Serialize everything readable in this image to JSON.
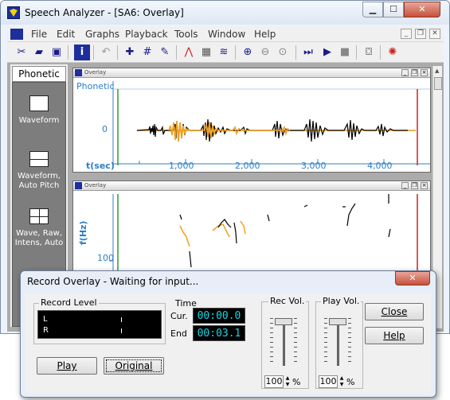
{
  "window": {
    "title": "Speech Analyzer - [SA6: Overlay]"
  },
  "menu": [
    "File",
    "Edit",
    "Graphs",
    "Playback",
    "Tools",
    "Window",
    "Help"
  ],
  "sidebar": {
    "tab": "Phonetic",
    "items": [
      {
        "label": "Waveform",
        "icon": "single-pane-icon"
      },
      {
        "label": "Waveform, Auto Pitch",
        "icon": "two-pane-icon"
      },
      {
        "label": "Wave, Raw, Intens, Auto",
        "icon": "four-pane-icon"
      }
    ]
  },
  "panes": [
    {
      "title": "Overlay",
      "row_label": "Phonetic",
      "y_tick": "0",
      "x_axis_label": "t(sec)",
      "x_ticks": [
        "1,000",
        "2,000",
        "3,000",
        "4,000"
      ]
    },
    {
      "title": "Overlay",
      "y_axis_label": "f(Hz)",
      "y_tick": "100"
    }
  ],
  "dialog": {
    "title": "Record Overlay - Waiting for input...",
    "record_level": {
      "label": "Record Level",
      "channels": [
        "L",
        "R"
      ]
    },
    "time": {
      "label": "Time",
      "cur_label": "Cur.",
      "end_label": "End",
      "cur_value": "00:00.0",
      "end_value": "00:03.1"
    },
    "rec_vol": {
      "label": "Rec Vol.",
      "value": "100",
      "unit": "%",
      "level": 1.0
    },
    "play_vol": {
      "label": "Play Vol.",
      "value": "100",
      "unit": "%",
      "level": 1.0
    },
    "buttons": {
      "play": "Play",
      "original": "Original",
      "close": "Close",
      "help": "Help"
    }
  },
  "colors": {
    "waveform": "#000000",
    "overlay": "#f0a020",
    "axis": "#2d7fc8",
    "cursor_start": "#2e9a3a",
    "cursor_end": "#cc2222",
    "lcd_text": "#19d6e6"
  }
}
